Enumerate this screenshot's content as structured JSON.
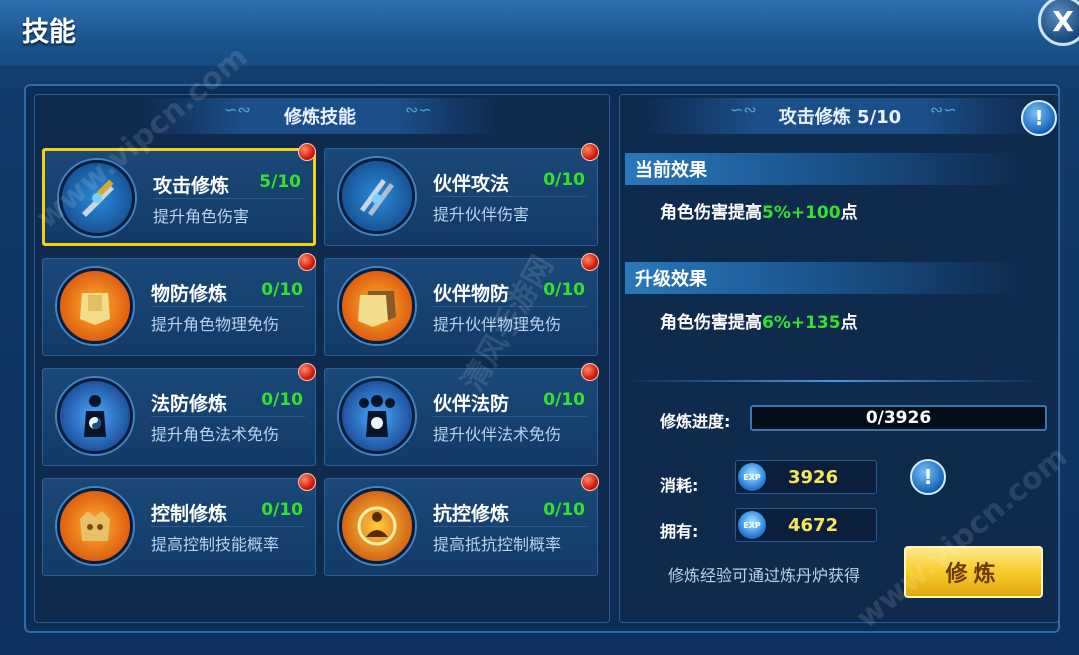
{
  "window": {
    "title": "技能",
    "close_label": "X"
  },
  "left_panel": {
    "title": "修炼技能",
    "skills": [
      {
        "name": "攻击修炼",
        "level": "5/10",
        "desc": "提升角色伤害",
        "icon": "sword-icon",
        "selected": true
      },
      {
        "name": "伙伴攻法",
        "level": "0/10",
        "desc": "提升伙伴伤害",
        "icon": "swords-icon",
        "selected": false
      },
      {
        "name": "物防修炼",
        "level": "0/10",
        "desc": "提升角色物理免伤",
        "icon": "armor-icon",
        "selected": false
      },
      {
        "name": "伙伴物防",
        "level": "0/10",
        "desc": "提升伙伴物理免伤",
        "icon": "armor-pair-icon",
        "selected": false
      },
      {
        "name": "法防修炼",
        "level": "0/10",
        "desc": "提升角色法术免伤",
        "icon": "yinyang-figure-icon",
        "selected": false
      },
      {
        "name": "伙伴法防",
        "level": "0/10",
        "desc": "提升伙伴法术免伤",
        "icon": "yinyang-group-icon",
        "selected": false
      },
      {
        "name": "控制修炼",
        "level": "0/10",
        "desc": "提高控制技能概率",
        "icon": "crown-icon",
        "selected": false
      },
      {
        "name": "抗控修炼",
        "level": "0/10",
        "desc": "提高抵抗控制概率",
        "icon": "meditation-icon",
        "selected": false
      }
    ]
  },
  "right_panel": {
    "title": "攻击修炼 5/10",
    "current_effect": {
      "header": "当前效果",
      "prefix": "角色伤害提高",
      "value": "5%+100",
      "suffix": "点"
    },
    "upgrade_effect": {
      "header": "升级效果",
      "prefix": "角色伤害提高",
      "value": "6%+135",
      "suffix": "点"
    },
    "progress_label": "修炼进度:",
    "progress_value": "0/3926",
    "progress_fraction": 0,
    "cost_label": "消耗:",
    "cost_value": "3926",
    "own_label": "拥有:",
    "own_value": "4672",
    "exp_icon_text": "EXP",
    "hint": "修炼经验可通过炼丹炉获得",
    "train_button": "修炼",
    "info_icon": "!"
  },
  "watermarks": [
    "www.vipcn.com",
    "清风手游网",
    "www.vipcn.com"
  ],
  "colors": {
    "accent_green": "#35e12e",
    "accent_yellow": "#f7e65a",
    "selected_border": "#f2d01a"
  }
}
